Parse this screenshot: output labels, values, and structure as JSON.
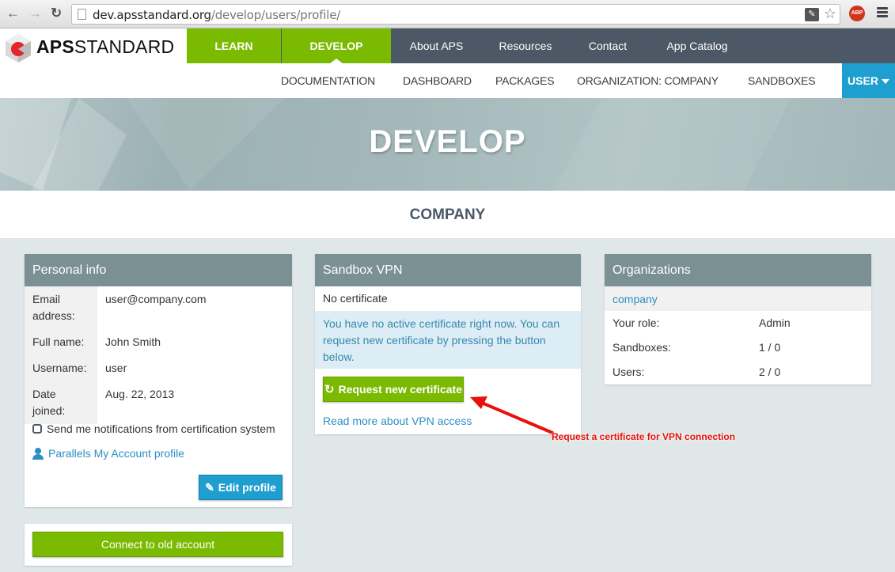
{
  "browser": {
    "url_domain": "dev.apsstandard.org",
    "url_path": "/develop/users/profile/",
    "icons": [
      "back-icon",
      "forward-icon",
      "reload-icon",
      "page-icon",
      "extension-icon",
      "star-icon",
      "adblock-icon",
      "menu-icon"
    ],
    "abp_label": "ABP"
  },
  "header": {
    "logo_bold": "APS",
    "logo_rest": "STANDARD",
    "main_nav": [
      {
        "label": "LEARN"
      },
      {
        "label": "DEVELOP",
        "active": true
      },
      {
        "label": "About APS"
      },
      {
        "label": "Resources"
      },
      {
        "label": "Contact"
      },
      {
        "label": "App Catalog"
      }
    ],
    "sub_nav": [
      {
        "label": "DOCUMENTATION"
      },
      {
        "label": "DASHBOARD"
      },
      {
        "label": "PACKAGES"
      },
      {
        "label": "ORGANIZATION: COMPANY"
      },
      {
        "label": "SANDBOXES"
      }
    ],
    "user_menu": "USER"
  },
  "banner": {
    "title": "DEVELOP"
  },
  "company": {
    "title": "COMPANY"
  },
  "personal_info": {
    "title": "Personal info",
    "rows": [
      {
        "label": "Email address:",
        "value": "user@company.com"
      },
      {
        "label": "Full name:",
        "value": "John Smith"
      },
      {
        "label": "Username:",
        "value": "user"
      },
      {
        "label": "Date joined:",
        "value": "Aug. 22, 2013"
      }
    ],
    "notify_label": "Send me notifications from certification system",
    "notify_checked": false,
    "account_link": "Parallels My Account profile",
    "edit_button": "Edit profile"
  },
  "connect": {
    "button": "Connect to old account"
  },
  "vpn": {
    "title": "Sandbox VPN",
    "status": "No certificate",
    "alert": "You have no active certificate right now. You can request new certificate by pressing the button below.",
    "request_button": "Request new certificate",
    "read_more": "Read more about VPN access"
  },
  "organizations": {
    "title": "Organizations",
    "name": "company",
    "rows": [
      {
        "label": "Your role:",
        "value": "Admin"
      },
      {
        "label": "Sandboxes:",
        "value": "1 / 0"
      },
      {
        "label": "Users:",
        "value": "2 / 0"
      }
    ]
  },
  "annotation": {
    "text": "Request a certificate for VPN connection",
    "color": "#e8100b"
  },
  "colors": {
    "green": "#7aba00",
    "dark": "#4c5866",
    "blue": "#1f9ed0",
    "panel_head": "#7a9093",
    "link": "#2a8fc2"
  }
}
